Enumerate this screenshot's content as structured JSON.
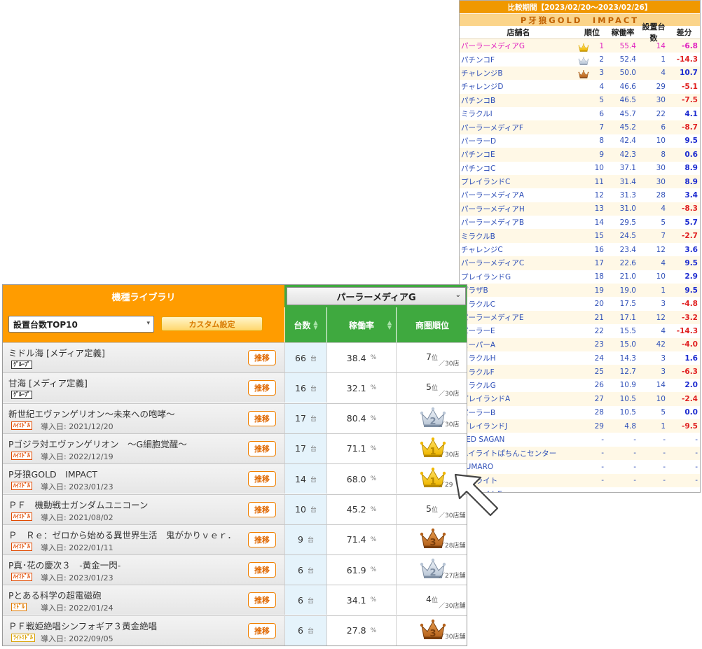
{
  "library": {
    "title": "機種ライブラリ",
    "store_select": "パーラーメディアG",
    "sort_select": "設置台数TOP10",
    "custom_button": "カスタム設定",
    "columns": {
      "count": "台数",
      "rate": "稼働率",
      "rank": "商圏順位"
    },
    "rows": [
      {
        "name": "ミドル海 [メディア定義]",
        "tag": "ｸﾞﾙｰﾌﾟ",
        "intro": "",
        "push": "推移",
        "count": "66",
        "count_unit": "台",
        "rate": "38.4",
        "rate_unit": "%",
        "rank": "7",
        "rank_unit": "位",
        "total": "／30店",
        "crown": ""
      },
      {
        "name": "甘海 [メディア定義]",
        "tag": "ｸﾞﾙｰﾌﾟ",
        "intro": "",
        "push": "推移",
        "count": "16",
        "count_unit": "台",
        "rate": "32.1",
        "rate_unit": "%",
        "rank": "5",
        "rank_unit": "位",
        "total": "／30店",
        "crown": ""
      },
      {
        "name": "新世紀エヴァンゲリオン～未来への咆哮～",
        "tag": "ﾊｲﾐﾄﾞﾙ",
        "intro": "導入日: 2021/12/20",
        "push": "推移",
        "count": "17",
        "count_unit": "台",
        "rate": "80.4",
        "rate_unit": "%",
        "rank": "2",
        "rank_unit": "",
        "total": "／30店",
        "crown": "silver"
      },
      {
        "name": "Pゴジラ対エヴァンゲリオン　～G細胞覚醒～",
        "tag": "ﾊｲﾐﾄﾞﾙ",
        "intro": "導入日: 2022/12/19",
        "push": "推移",
        "count": "17",
        "count_unit": "台",
        "rate": "71.1",
        "rate_unit": "%",
        "rank": "1",
        "rank_unit": "",
        "total": "／30店",
        "crown": "gold"
      },
      {
        "name": "P牙狼GOLD　IMPACT",
        "tag": "ﾊｲﾐﾄﾞﾙ",
        "intro": "導入日: 2023/01/23",
        "push": "推移",
        "count": "14",
        "count_unit": "台",
        "rate": "68.0",
        "rate_unit": "%",
        "rank": "1",
        "rank_unit": "",
        "total": "／29",
        "crown": "gold"
      },
      {
        "name": "ＰＦ　機動戦士ガンダムユニコーン",
        "tag": "ﾊｲﾐﾄﾞﾙ",
        "intro": "導入日: 2021/08/02",
        "push": "推移",
        "count": "10",
        "count_unit": "台",
        "rate": "45.2",
        "rate_unit": "%",
        "rank": "5",
        "rank_unit": "位",
        "total": "／30店舗",
        "crown": ""
      },
      {
        "name": "Ｐ　Ｒｅ：ゼロから始める異世界生活　鬼がかりｖｅｒ．",
        "tag": "ﾊｲﾐﾄﾞﾙ",
        "intro": "導入日: 2022/01/11",
        "push": "推移",
        "count": "9",
        "count_unit": "台",
        "rate": "71.4",
        "rate_unit": "%",
        "rank": "3",
        "rank_unit": "",
        "total": "／28店舗",
        "crown": "bronze"
      },
      {
        "name": "P真･花の慶次３　-黄金一閃-",
        "tag": "ﾊｲﾐﾄﾞﾙ",
        "intro": "導入日: 2023/01/23",
        "push": "推移",
        "count": "6",
        "count_unit": "台",
        "rate": "61.9",
        "rate_unit": "%",
        "rank": "2",
        "rank_unit": "",
        "total": "／27店舗",
        "crown": "silver"
      },
      {
        "name": "Pとある科学の超電磁砲",
        "tag": "ﾐﾄﾞﾙ",
        "intro": "導入日: 2022/01/24",
        "push": "推移",
        "count": "6",
        "count_unit": "台",
        "rate": "34.1",
        "rate_unit": "%",
        "rank": "4",
        "rank_unit": "位",
        "total": "／30店舗",
        "crown": ""
      },
      {
        "name": "ＰＦ戦姫絶唱シンフォギア３黄金絶唱",
        "tag": "ﾗｲﾄﾐﾄﾞﾙ",
        "intro": "導入日: 2022/09/05",
        "push": "推移",
        "count": "6",
        "count_unit": "台",
        "rate": "27.8",
        "rate_unit": "%",
        "rank": "3",
        "rank_unit": "",
        "total": "／30店舗",
        "crown": "bronze"
      }
    ]
  },
  "comparison": {
    "period": "比較期間【2023/02/20～2023/02/26】",
    "machine": "P牙狼GOLD　IMPACT",
    "headers": {
      "store": "店舗名",
      "rank": "順位",
      "rate": "稼働率",
      "units": "設置台数",
      "diff": "差分"
    },
    "rows": [
      {
        "store": "パーラーメディアG",
        "rank": "1",
        "rate": "55.4",
        "units": "14",
        "diff": "-6.8",
        "crown": "gold",
        "highlight": true
      },
      {
        "store": "パチンコF",
        "rank": "2",
        "rate": "52.4",
        "units": "1",
        "diff": "-14.3",
        "crown": "silver"
      },
      {
        "store": "チャレンジB",
        "rank": "3",
        "rate": "50.0",
        "units": "4",
        "diff": "10.7",
        "crown": "bronze"
      },
      {
        "store": "チャレンジD",
        "rank": "4",
        "rate": "46.6",
        "units": "29",
        "diff": "-5.1"
      },
      {
        "store": "パチンコB",
        "rank": "5",
        "rate": "46.5",
        "units": "30",
        "diff": "-7.5"
      },
      {
        "store": "ミラクルI",
        "rank": "6",
        "rate": "45.7",
        "units": "22",
        "diff": "4.1"
      },
      {
        "store": "パーラーメディアF",
        "rank": "7",
        "rate": "45.2",
        "units": "6",
        "diff": "-8.7"
      },
      {
        "store": "パーラーD",
        "rank": "8",
        "rate": "42.4",
        "units": "10",
        "diff": "9.5"
      },
      {
        "store": "パチンコE",
        "rank": "9",
        "rate": "42.3",
        "units": "8",
        "diff": "0.6"
      },
      {
        "store": "パチンコC",
        "rank": "10",
        "rate": "37.1",
        "units": "30",
        "diff": "8.9"
      },
      {
        "store": "プレイランドC",
        "rank": "11",
        "rate": "31.4",
        "units": "30",
        "diff": "8.9"
      },
      {
        "store": "パーラーメディアA",
        "rank": "12",
        "rate": "31.3",
        "units": "28",
        "diff": "3.4"
      },
      {
        "store": "パーラーメディアH",
        "rank": "13",
        "rate": "31.0",
        "units": "4",
        "diff": "-8.3"
      },
      {
        "store": "パーラーメディアB",
        "rank": "14",
        "rate": "29.5",
        "units": "5",
        "diff": "5.7"
      },
      {
        "store": "ミラクルB",
        "rank": "15",
        "rate": "24.5",
        "units": "7",
        "diff": "-2.7"
      },
      {
        "store": "チャレンジC",
        "rank": "16",
        "rate": "23.4",
        "units": "12",
        "diff": "3.6"
      },
      {
        "store": "パーラーメディアC",
        "rank": "17",
        "rate": "22.6",
        "units": "4",
        "diff": "9.5"
      },
      {
        "store": "プレイランドG",
        "rank": "18",
        "rate": "21.0",
        "units": "10",
        "diff": "2.9"
      },
      {
        "store": "プラザB",
        "rank": "19",
        "rate": "19.0",
        "units": "1",
        "diff": "9.5"
      },
      {
        "store": "ミラクルC",
        "rank": "20",
        "rate": "17.5",
        "units": "3",
        "diff": "-4.8"
      },
      {
        "store": "パーラーメディアE",
        "rank": "21",
        "rate": "17.1",
        "units": "12",
        "diff": "-3.2"
      },
      {
        "store": "パーラーE",
        "rank": "22",
        "rate": "15.5",
        "units": "4",
        "diff": "-14.3"
      },
      {
        "store": "スーパーA",
        "rank": "23",
        "rate": "15.0",
        "units": "42",
        "diff": "-4.0"
      },
      {
        "store": "ミラクルH",
        "rank": "24",
        "rate": "14.3",
        "units": "3",
        "diff": "1.6"
      },
      {
        "store": "ミラクルF",
        "rank": "25",
        "rate": "12.7",
        "units": "3",
        "diff": "-6.3"
      },
      {
        "store": "ミラクルG",
        "rank": "26",
        "rate": "10.9",
        "units": "14",
        "diff": "2.0"
      },
      {
        "store": "プレイランドA",
        "rank": "27",
        "rate": "10.5",
        "units": "10",
        "diff": "-2.4"
      },
      {
        "store": "パーラーB",
        "rank": "28",
        "rate": "10.5",
        "units": "5",
        "diff": "0.0"
      },
      {
        "store": "プレイランドJ",
        "rank": "29",
        "rate": "4.8",
        "units": "1",
        "diff": "-9.5"
      },
      {
        "store": "RED SAGAN",
        "rank": "-",
        "rate": "-",
        "units": "-",
        "diff": "-"
      },
      {
        "store": "ハイライトぱちんこセンター",
        "rank": "-",
        "rate": "-",
        "units": "-",
        "diff": "-"
      },
      {
        "store": "SUMARO",
        "rank": "-",
        "rate": "-",
        "units": "-",
        "diff": "-"
      },
      {
        "store": "ハイライト",
        "rank": "-",
        "rate": "-",
        "units": "-",
        "diff": "-"
      },
      {
        "store": "ハイライトE",
        "rank": "-",
        "rate": "-",
        "units": "-",
        "diff": "-"
      }
    ]
  },
  "colors": {
    "orange": "#ff9c00",
    "green": "#3fa93f",
    "gold": "#f2c400",
    "silver": "#b9c6d6",
    "bronze": "#b5621c",
    "negative": "#e02020",
    "positive": "#1c2bd0",
    "highlight": "#e020c0"
  },
  "icons": {
    "crown": "crown-icon",
    "pointer": "arrow-pointer-icon",
    "caret": "chevron-down-icon",
    "sort": "sort-icon"
  }
}
